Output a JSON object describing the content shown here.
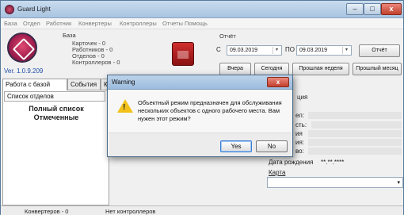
{
  "window": {
    "title": "Guard Light",
    "min": "–",
    "max": "□",
    "close": "x"
  },
  "menu": [
    "База",
    "Отдел",
    "Работник",
    "Конвертеры",
    "Контроллеры",
    "Отчеты",
    "Помощь"
  ],
  "header": {
    "version": "Ver. 1.0.9.209",
    "base_label": "База",
    "stats": [
      "Карточек - 0",
      "Работников - 0",
      "Отделов - 0",
      "Контроллеров - 0"
    ],
    "report_label": "Отчёт",
    "from_label": "С",
    "to_label": "ПО",
    "date_from": "09.03.2019",
    "date_to": "09.03.2019",
    "report_button": "Отчёт",
    "yesterday_button": "Вчера",
    "today_button": "Сегодня",
    "last_week_button": "Прошлая неделя",
    "last_month_button": "Прошлый месяц"
  },
  "tabs": [
    "Работа с базой",
    "События",
    "К"
  ],
  "left_panel": {
    "header": "Список отделов",
    "items": [
      "Полный список",
      "Отмеченные"
    ]
  },
  "right_panel": {
    "section": "ция",
    "fields": [
      "ел:",
      "сть:",
      "ия",
      "ия:",
      "во:"
    ],
    "birth_label": "Дата рождения",
    "birth_value": "**.**.****",
    "card_label": "Карта"
  },
  "status": {
    "converters": "Конвертеров - 0",
    "controllers": "Нет контроллеров"
  },
  "dialog": {
    "title": "Warning",
    "close": "x",
    "message": "Объектный режим предназначен для обслуживания нескольких объектов с одного рабочего места. Вам нужен этот режим?",
    "yes": "Yes",
    "no": "No"
  }
}
